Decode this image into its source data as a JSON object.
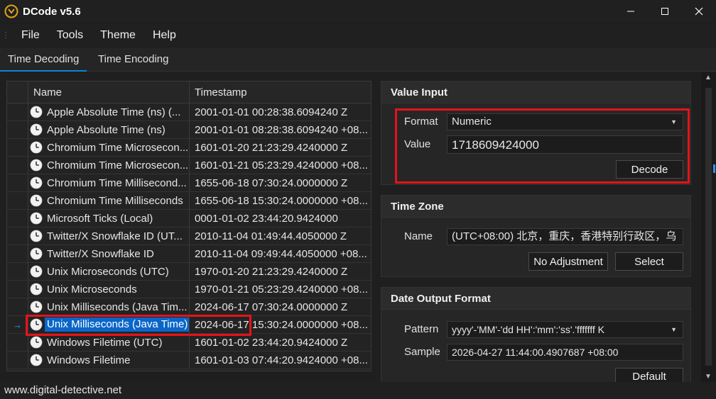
{
  "window": {
    "title": "DCode v5.6"
  },
  "menu": {
    "items": [
      "File",
      "Tools",
      "Theme",
      "Help"
    ]
  },
  "tabs": [
    "Time Decoding",
    "Time Encoding"
  ],
  "grid": {
    "columns": [
      "Name",
      "Timestamp"
    ],
    "rows": [
      {
        "name": "Apple Absolute Time (ns) (...",
        "timestamp": "2001-01-01 00:28:38.6094240 Z"
      },
      {
        "name": "Apple Absolute Time (ns)",
        "timestamp": "2001-01-01 08:28:38.6094240 +08..."
      },
      {
        "name": "Chromium Time Microsecon...",
        "timestamp": "1601-01-20 21:23:29.4240000 Z"
      },
      {
        "name": "Chromium Time Microsecon...",
        "timestamp": "1601-01-21 05:23:29.4240000 +08..."
      },
      {
        "name": "Chromium Time Millisecond...",
        "timestamp": "1655-06-18 07:30:24.0000000 Z"
      },
      {
        "name": "Chromium Time Milliseconds",
        "timestamp": "1655-06-18 15:30:24.0000000 +08..."
      },
      {
        "name": "Microsoft Ticks (Local)",
        "timestamp": "0001-01-02 23:44:20.9424000"
      },
      {
        "name": "Twitter/X Snowflake ID (UT...",
        "timestamp": "2010-11-04 01:49:44.4050000 Z"
      },
      {
        "name": "Twitter/X Snowflake ID",
        "timestamp": "2010-11-04 09:49:44.4050000 +08..."
      },
      {
        "name": "Unix Microseconds (UTC)",
        "timestamp": "1970-01-20 21:23:29.4240000 Z"
      },
      {
        "name": "Unix Microseconds",
        "timestamp": "1970-01-21 05:23:29.4240000 +08..."
      },
      {
        "name": "Unix Milliseconds (Java Tim...",
        "timestamp": "2024-06-17 07:30:24.0000000 Z"
      },
      {
        "name": "Unix Milliseconds (Java Time)",
        "timestamp": "2024-06-17 15:30:24.0000000 +08..."
      },
      {
        "name": "Windows Filetime (UTC)",
        "timestamp": "1601-01-02 23:44:20.9424000 Z"
      },
      {
        "name": "Windows Filetime",
        "timestamp": "1601-01-03 07:44:20.9424000 +08..."
      }
    ],
    "selected_index": 12
  },
  "value_input": {
    "title": "Value Input",
    "format_label": "Format",
    "format_value": "Numeric",
    "value_label": "Value",
    "value": "1718609424000",
    "decode_button": "Decode"
  },
  "time_zone": {
    "title": "Time Zone",
    "name_label": "Name",
    "name_value": "(UTC+08:00) 北京，重庆，香港特别行政区，乌",
    "no_adjustment_button": "No Adjustment",
    "select_button": "Select"
  },
  "date_output": {
    "title": "Date Output Format",
    "pattern_label": "Pattern",
    "pattern_value": "yyyy'-'MM'-'dd HH':'mm':'ss'.'fffffff K",
    "sample_label": "Sample",
    "sample_value": "2026-04-27 11:44:00.4907687 +08:00",
    "default_button": "Default"
  },
  "status": {
    "text": "www.digital-detective.net"
  },
  "colors": {
    "accent": "#0a84d6",
    "selection": "#0a66c8",
    "highlight": "#e3141a"
  }
}
